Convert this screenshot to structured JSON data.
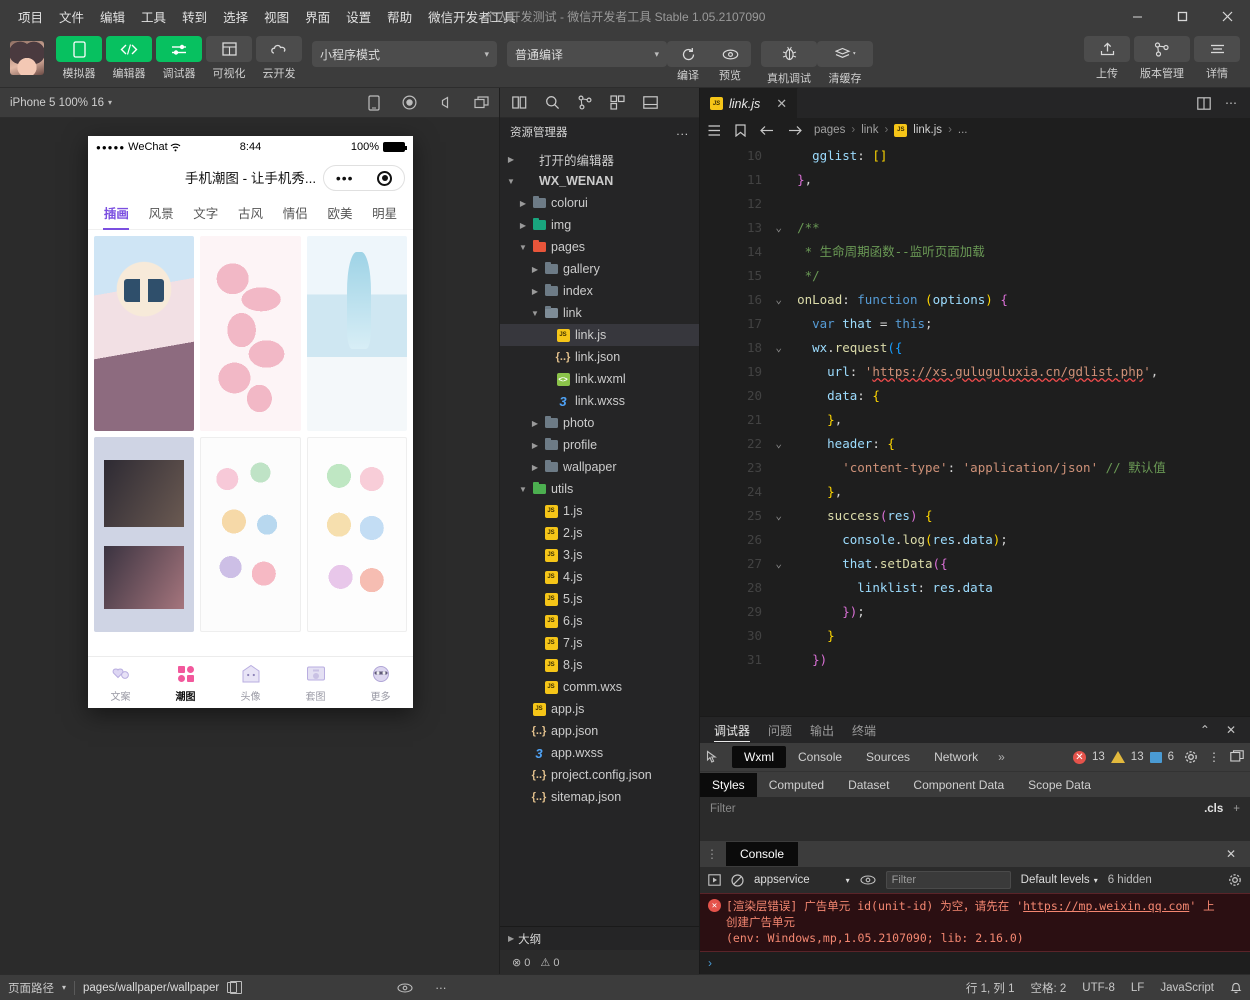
{
  "window": {
    "title": "个人开发测试 - 微信开发者工具 Stable 1.05.2107090",
    "minimize": "−",
    "maximize": "▢",
    "close": "✕"
  },
  "menubar": {
    "items": [
      {
        "label": "项目"
      },
      {
        "label": "文件"
      },
      {
        "label": "编辑"
      },
      {
        "label": "工具"
      },
      {
        "label": "转到"
      },
      {
        "label": "选择"
      },
      {
        "label": "视图"
      },
      {
        "label": "界面"
      },
      {
        "label": "设置"
      },
      {
        "label": "帮助"
      },
      {
        "label": "微信开发者工具"
      }
    ]
  },
  "toolbar": {
    "left_buttons": [
      {
        "label": "模拟器",
        "icon": "phone-icon",
        "active": true
      },
      {
        "label": "编辑器",
        "icon": "code-icon",
        "active": true
      },
      {
        "label": "调试器",
        "icon": "debugger-icon",
        "active": true
      },
      {
        "label": "可视化",
        "icon": "layout-icon",
        "active": false
      },
      {
        "label": "云开发",
        "icon": "cloud-icon",
        "active": false
      }
    ],
    "mode_select": {
      "value": "小程序模式",
      "caret": "▾"
    },
    "compile_select": {
      "value": "普通编译",
      "caret": "▾"
    },
    "compile_label": "编译",
    "preview_label": "预览",
    "remote_debug_label": "真机调试",
    "clear_cache_label": "清缓存",
    "right_buttons": [
      {
        "label": "上传",
        "icon": "upload-icon"
      },
      {
        "label": "版本管理",
        "icon": "branch-icon"
      },
      {
        "label": "详情",
        "icon": "details-icon"
      }
    ]
  },
  "simulator": {
    "device_label": "iPhone 5 100% 16",
    "device_caret": "▾",
    "phone": {
      "status": {
        "signal": "●●●●●",
        "carrier": "WeChat",
        "wifi": "🛜",
        "time": "8:44",
        "battery_pct": "100%"
      },
      "nav_title": "手机潮图 - 让手机秀...",
      "capsule_dots": "•••",
      "tabs": [
        {
          "label": "插画",
          "active": true
        },
        {
          "label": "风景",
          "active": false
        },
        {
          "label": "文字",
          "active": false
        },
        {
          "label": "古风",
          "active": false
        },
        {
          "label": "情侣",
          "active": false
        },
        {
          "label": "欧美",
          "active": false
        },
        {
          "label": "明星",
          "active": false
        }
      ],
      "cards": [
        {
          "name": "anime-girl-image"
        },
        {
          "name": "pink-pattern-image"
        },
        {
          "name": "blue-gradient-image"
        },
        {
          "name": "photo-collage-image"
        },
        {
          "name": "sticker-sheet-image"
        },
        {
          "name": "cartoon-sticker-image"
        }
      ],
      "tabbar": [
        {
          "label": "文案",
          "active": false
        },
        {
          "label": "潮图",
          "active": true
        },
        {
          "label": "头像",
          "active": false
        },
        {
          "label": "套图",
          "active": false
        },
        {
          "label": "更多",
          "active": false
        }
      ]
    }
  },
  "explorer": {
    "title": "资源管理器",
    "more": "...",
    "open_editors": "打开的编辑器",
    "project_name": "WX_WENAN",
    "outline": "大纲",
    "problems": {
      "errors": "0",
      "warnings": "0"
    },
    "tree": [
      {
        "label": "colorui",
        "indent": 1,
        "type": "folder",
        "state": "collapsed",
        "color": "gray"
      },
      {
        "label": "img",
        "indent": 1,
        "type": "folder",
        "state": "collapsed",
        "color": "teal"
      },
      {
        "label": "pages",
        "indent": 1,
        "type": "folder",
        "state": "expanded",
        "color": "red"
      },
      {
        "label": "gallery",
        "indent": 2,
        "type": "folder",
        "state": "collapsed",
        "color": "gray"
      },
      {
        "label": "index",
        "indent": 2,
        "type": "folder",
        "state": "collapsed",
        "color": "gray"
      },
      {
        "label": "link",
        "indent": 2,
        "type": "folder",
        "state": "expanded",
        "color": "gray"
      },
      {
        "label": "link.js",
        "indent": 3,
        "type": "js",
        "selected": true
      },
      {
        "label": "link.json",
        "indent": 3,
        "type": "json"
      },
      {
        "label": "link.wxml",
        "indent": 3,
        "type": "wxml"
      },
      {
        "label": "link.wxss",
        "indent": 3,
        "type": "wxss"
      },
      {
        "label": "photo",
        "indent": 2,
        "type": "folder",
        "state": "collapsed",
        "color": "gray"
      },
      {
        "label": "profile",
        "indent": 2,
        "type": "folder",
        "state": "collapsed",
        "color": "gray"
      },
      {
        "label": "wallpaper",
        "indent": 2,
        "type": "folder",
        "state": "collapsed",
        "color": "gray"
      },
      {
        "label": "utils",
        "indent": 1,
        "type": "folder",
        "state": "expanded",
        "color": "green"
      },
      {
        "label": "1.js",
        "indent": 2,
        "type": "js"
      },
      {
        "label": "2.js",
        "indent": 2,
        "type": "js"
      },
      {
        "label": "3.js",
        "indent": 2,
        "type": "js"
      },
      {
        "label": "4.js",
        "indent": 2,
        "type": "js"
      },
      {
        "label": "5.js",
        "indent": 2,
        "type": "js"
      },
      {
        "label": "6.js",
        "indent": 2,
        "type": "js"
      },
      {
        "label": "7.js",
        "indent": 2,
        "type": "js"
      },
      {
        "label": "8.js",
        "indent": 2,
        "type": "js"
      },
      {
        "label": "comm.wxs",
        "indent": 2,
        "type": "js"
      },
      {
        "label": "app.js",
        "indent": 1,
        "type": "js"
      },
      {
        "label": "app.json",
        "indent": 1,
        "type": "json"
      },
      {
        "label": "app.wxss",
        "indent": 1,
        "type": "wxss"
      },
      {
        "label": "project.config.json",
        "indent": 1,
        "type": "json"
      },
      {
        "label": "sitemap.json",
        "indent": 1,
        "type": "json"
      }
    ]
  },
  "editor": {
    "tab": {
      "label": "link.js",
      "close": "✕"
    },
    "breadcrumb": [
      "pages",
      "link",
      "link.js",
      "..."
    ],
    "first_line_number": 10,
    "lines": [
      {
        "n": 10,
        "fold": false,
        "html": "    <span class='prop'>gglist</span>: <span class='par'>[]</span>"
      },
      {
        "n": 11,
        "fold": false,
        "html": "  <span class='par2'>}</span>,"
      },
      {
        "n": 12,
        "fold": false,
        "html": ""
      },
      {
        "n": 13,
        "fold": true,
        "html": "  <span class='cm'>/**</span>"
      },
      {
        "n": 14,
        "fold": false,
        "html": "  <span class='cm'> * 生命周期函数--监听页面加载</span>"
      },
      {
        "n": 15,
        "fold": false,
        "html": "  <span class='cm'> */</span>"
      },
      {
        "n": 16,
        "fold": true,
        "html": "  <span class='fn'>onLoad</span>: <span class='k'>function</span> <span class='par'>(</span><span class='var'>options</span><span class='par'>)</span> <span class='par2'>{</span>"
      },
      {
        "n": 17,
        "fold": false,
        "html": "    <span class='k'>var</span> <span class='var'>that</span> = <span class='ths'>this</span>;"
      },
      {
        "n": 18,
        "fold": true,
        "html": "    <span class='var'>wx</span>.<span class='fn'>request</span><span class='par3'>({</span>"
      },
      {
        "n": 19,
        "fold": false,
        "html": "      <span class='prop'>url</span>: <span class='str'>'</span><span class='link'>https://xs.guluguluxia.cn/gdlist.php</span><span class='str'>'</span>,"
      },
      {
        "n": 20,
        "fold": false,
        "html": "      <span class='prop'>data</span>: <span class='par'>{</span>"
      },
      {
        "n": 21,
        "fold": false,
        "html": "      <span class='par'>}</span>,"
      },
      {
        "n": 22,
        "fold": true,
        "html": "      <span class='prop'>header</span>: <span class='par'>{</span>"
      },
      {
        "n": 23,
        "fold": false,
        "html": "        <span class='str'>'content-type'</span>: <span class='str'>'application/json'</span> <span class='cm'>// 默认值</span>"
      },
      {
        "n": 24,
        "fold": false,
        "html": "      <span class='par'>}</span>,"
      },
      {
        "n": 25,
        "fold": true,
        "html": "      <span class='fn'>success</span><span class='par2'>(</span><span class='var'>res</span><span class='par2'>)</span> <span class='par'>{</span>"
      },
      {
        "n": 26,
        "fold": false,
        "html": "        <span class='var'>console</span>.<span class='fn'>log</span><span class='par'>(</span><span class='var'>res</span>.<span class='prop'>data</span><span class='par'>)</span>;"
      },
      {
        "n": 27,
        "fold": true,
        "html": "        <span class='var'>that</span>.<span class='fn'>setData</span><span class='par2'>({</span>"
      },
      {
        "n": 28,
        "fold": false,
        "html": "          <span class='prop'>linklist</span>: <span class='var'>res</span>.<span class='prop'>data</span>"
      },
      {
        "n": 29,
        "fold": false,
        "html": "        <span class='par2'>})</span>;"
      },
      {
        "n": 30,
        "fold": false,
        "html": "      <span class='par'>}</span>"
      },
      {
        "n": 31,
        "fold": false,
        "html": "    <span class='par2'>})</span>"
      }
    ]
  },
  "devpanel": {
    "tabs": [
      {
        "label": "调试器",
        "active": true
      },
      {
        "label": "问题",
        "active": false
      },
      {
        "label": "输出",
        "active": false
      },
      {
        "label": "终端",
        "active": false
      }
    ],
    "collapse_icon": "⌃",
    "close_icon": "✕",
    "devtools_tabs": [
      {
        "label": "Wxml",
        "active": true
      },
      {
        "label": "Console",
        "active": false
      },
      {
        "label": "Sources",
        "active": false
      },
      {
        "label": "Network",
        "active": false
      }
    ],
    "overflow": "»",
    "badges": {
      "errors": "13",
      "warnings": "13",
      "info": "6"
    },
    "style_tabs": [
      {
        "label": "Styles",
        "active": true
      },
      {
        "label": "Computed",
        "active": false
      },
      {
        "label": "Dataset",
        "active": false
      },
      {
        "label": "Component Data",
        "active": false
      },
      {
        "label": "Scope Data",
        "active": false
      }
    ],
    "filter_placeholder": "Filter",
    "cls_label": ".cls",
    "plus_label": "+"
  },
  "console": {
    "tab_label": "Console",
    "close_icon": "✕",
    "context": "appservice",
    "context_caret": "▾",
    "filter_placeholder": "Filter",
    "levels": "Default levels",
    "levels_caret": "▾",
    "hidden_count": "6 hidden",
    "error": {
      "line1_prefix": "[渲染层错误] 广告单元 id(unit-id) 为空，请先在 ",
      "link": "https://mp.weixin.qq.com",
      "line1_suffix": " 上",
      "line2": "创建广告单元",
      "line3": "(env: Windows,mp,1.05.2107090; lib: 2.16.0)"
    },
    "prompt": "›"
  },
  "statusbar": {
    "page_path_label": "页面路径",
    "page_path_caret": "▾",
    "page_path_value": "pages/wallpaper/wallpaper",
    "cursor": "行 1, 列 1",
    "spaces": "空格: 2",
    "encoding": "UTF-8",
    "eol": "LF",
    "language": "JavaScript",
    "bell": "🔔"
  },
  "colors": {
    "accent_green": "#07c160",
    "titlebar_bg": "#3c3c3c",
    "editor_bg": "#1e1e1e",
    "explorer_bg": "#252526",
    "error_red": "#e5534b",
    "warning_yellow": "#e2b93d",
    "phone_accent_purple": "#7b4fe0"
  }
}
